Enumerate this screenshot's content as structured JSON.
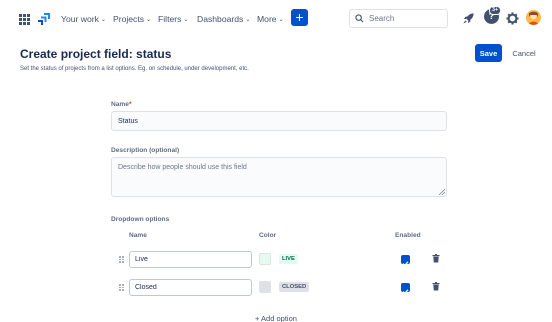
{
  "topnav": {
    "items": [
      {
        "label": "Your work"
      },
      {
        "label": "Projects"
      },
      {
        "label": "Filters"
      },
      {
        "label": "Dashboards"
      },
      {
        "label": "More"
      }
    ],
    "create_label": "+",
    "search": {
      "placeholder": "Search",
      "value": ""
    },
    "help_badge": "3+",
    "help_label": "?",
    "icons": [
      "apps-icon",
      "jira-logo-icon",
      "search-icon",
      "rocket-icon",
      "help-icon",
      "gear-icon",
      "avatar"
    ]
  },
  "header": {
    "title": "Create project field: status",
    "subtitle": "Set the status of projects from a list options. Eg. on schedule, under development, etc.",
    "save_label": "Save",
    "cancel_label": "Cancel"
  },
  "form": {
    "name_label": "Name",
    "name_required_mark": "*",
    "name_value": "Status",
    "description_label": "Description (optional)",
    "description_placeholder": "Describe how people should use this field",
    "dropdown_label": "Dropdown options",
    "columns": {
      "name": "Name",
      "color": "Color",
      "enabled": "Enabled"
    },
    "options": [
      {
        "name": "Live",
        "lozenge": "LIVE",
        "swatch_color": "#e3fcef",
        "lozenge_bg": "#e3fcef",
        "lozenge_color": "#006644",
        "enabled": true
      },
      {
        "name": "Closed",
        "lozenge": "CLOSED",
        "swatch_color": "#dfe1e6",
        "lozenge_bg": "#dfe1e6",
        "lozenge_color": "#42526e",
        "enabled": true
      }
    ],
    "add_option_label": "+  Add option"
  },
  "colors": {
    "brand": "#0052cc",
    "text": "#172b4d",
    "subtle_text": "#42526e"
  }
}
